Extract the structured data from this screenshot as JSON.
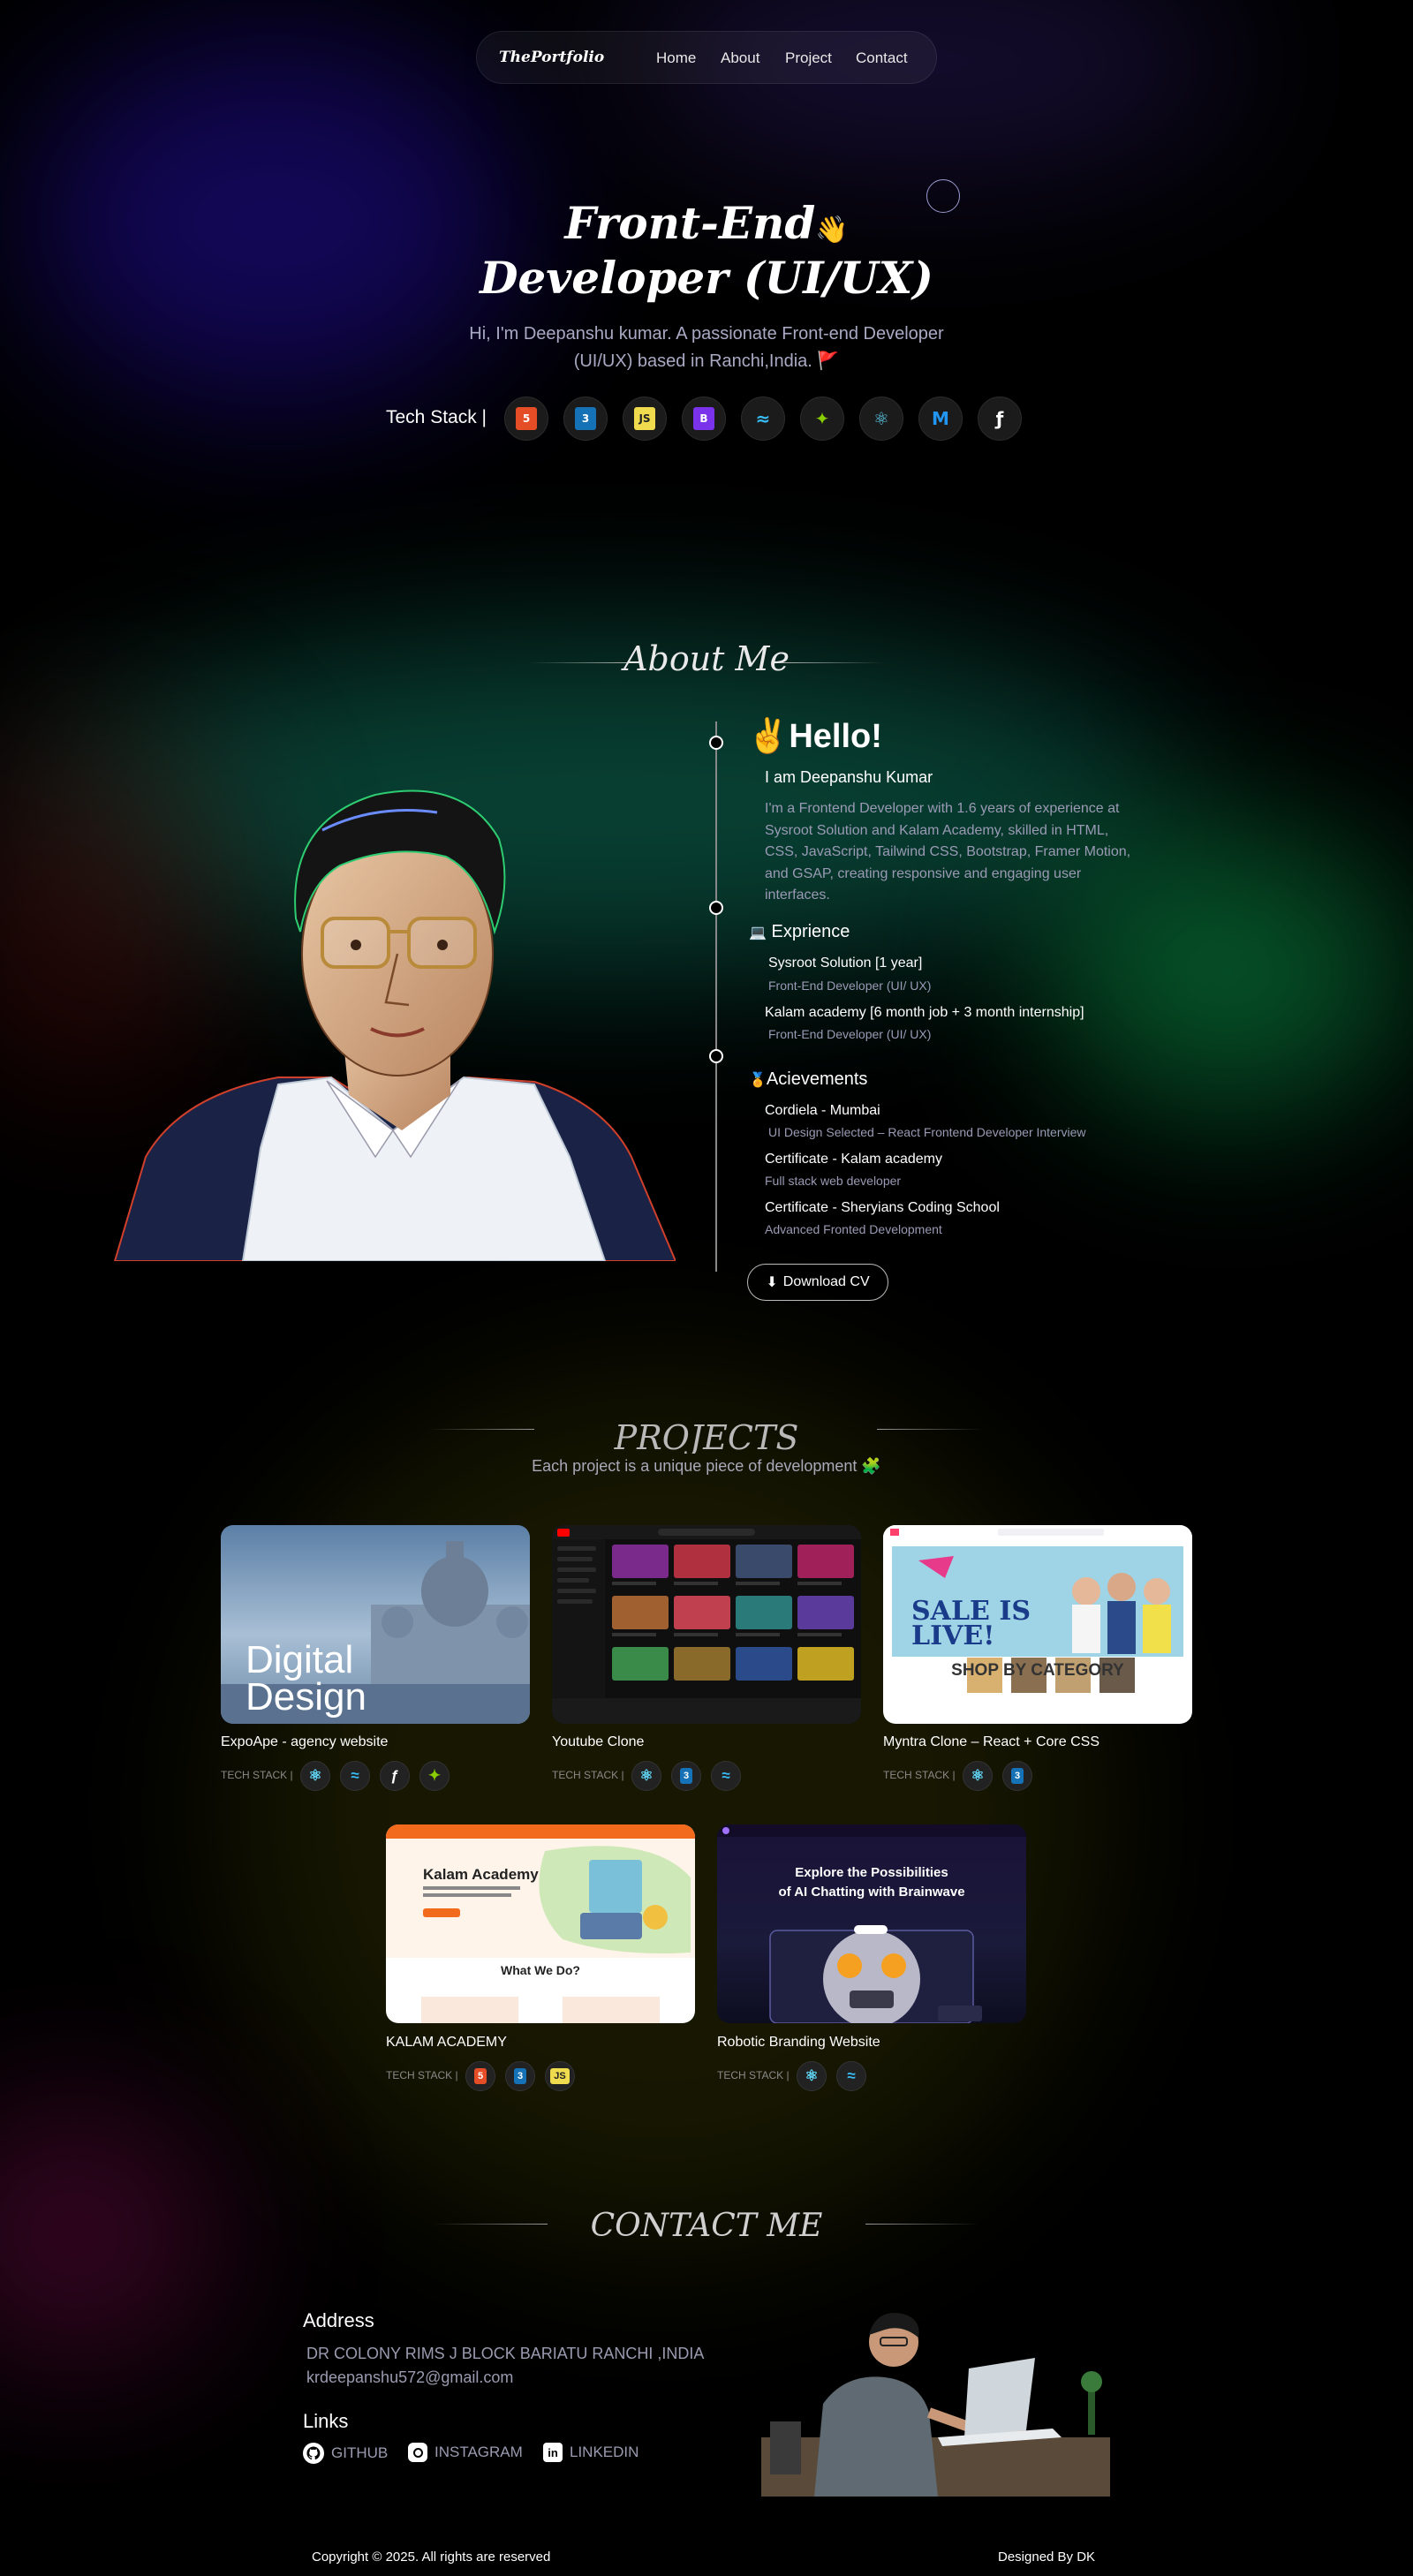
{
  "nav": {
    "logo": "ThePortfolio",
    "links": [
      "Home",
      "About",
      "Project",
      "Contact"
    ]
  },
  "hero": {
    "title_line1": "Front-End",
    "title_emoji": "👋",
    "title_line2": "Developer (UI/UX)",
    "subtitle_line1": "Hi, I'm Deepanshu kumar. A passionate Front-end Developer",
    "subtitle_line2": "(UI/UX) based in Ranchi,India.",
    "subtitle_flag": "🚩",
    "tech_label": "Tech Stack  |",
    "tech_icons": [
      {
        "icon": "html5-icon",
        "text": "5",
        "bg": "#e44d26",
        "fg": "#fff"
      },
      {
        "icon": "css3-icon",
        "text": "3",
        "bg": "#1572b6",
        "fg": "#fff"
      },
      {
        "icon": "javascript-icon",
        "text": "JS",
        "bg": "#f0db4f",
        "fg": "#222"
      },
      {
        "icon": "bootstrap-icon",
        "text": "B",
        "bg": "#7a33ea",
        "fg": "#fff"
      },
      {
        "icon": "tailwind-icon",
        "text": "≈",
        "bg": "transparent",
        "fg": "#38bdf8"
      },
      {
        "icon": "gsap-icon",
        "text": "✦",
        "bg": "transparent",
        "fg": "#88ce02"
      },
      {
        "icon": "react-icon",
        "text": "⚛",
        "bg": "transparent",
        "fg": "#61dafb"
      },
      {
        "icon": "mui-icon",
        "text": "M",
        "bg": "transparent",
        "fg": "#2196f3"
      },
      {
        "icon": "framer-motion-icon",
        "text": "ƒ",
        "bg": "transparent",
        "fg": "#fff"
      }
    ]
  },
  "about": {
    "heading": "About Me",
    "hello_emoji": "✌",
    "hello": "Hello!",
    "name": "I am Deepanshu Kumar",
    "bio_lines": [
      "I'm a Frontend Developer with 1.6 years of experience at",
      "Sysroot Solution and Kalam Academy, skilled in HTML,",
      "CSS, JavaScript, Tailwind CSS, Bootstrap, Framer Motion,",
      "and GSAP, creating responsive and engaging user",
      "interfaces."
    ],
    "experience_emoji": "💻",
    "experience_title": "Exprience",
    "experience": [
      {
        "company": "Sysroot Solution [1 year]",
        "role": "Front-End Developer (UI/ UX)"
      },
      {
        "company": "Kalam academy [6 month job + 3 month internship]",
        "role": "Front-End Developer (UI/ UX)"
      }
    ],
    "achievements_emoji": "🏅",
    "achievements_title": "Acievements",
    "achievements": [
      {
        "title": "Cordiela - Mumbai",
        "desc": "UI Design Selected – React Frontend Developer Interview"
      },
      {
        "title": "Certificate - Kalam academy",
        "desc": "Full stack web developer"
      },
      {
        "title": "Certificate - Sheryians Coding School",
        "desc": "Advanced Fronted Development"
      }
    ],
    "download_cv": "Download CV"
  },
  "projects": {
    "heading": "PROJECTS",
    "subtitle": "Each project is a unique piece of development",
    "subtitle_emoji": "🧩",
    "tech_label": "TECH STACK |",
    "items": [
      {
        "title": "ExpoApe - agency website",
        "thumb_text_1": "Digital",
        "thumb_text_2": "Design",
        "stack": [
          "react-icon",
          "tailwind-icon",
          "framer-motion-icon",
          "gsap-icon"
        ]
      },
      {
        "title": "Youtube Clone",
        "stack": [
          "react-icon",
          "css3-icon",
          "tailwind-icon"
        ]
      },
      {
        "title": "Myntra Clone – React + Core CSS",
        "thumb_text_1": "SALE IS",
        "thumb_text_2": "LIVE!",
        "thumb_text_3": "SHOP BY CATEGORY",
        "stack": [
          "react-icon",
          "css3-icon"
        ]
      },
      {
        "title": "KALAM ACADEMY",
        "thumb_text_1": "Kalam Academy",
        "thumb_text_2": "What We Do?",
        "stack": [
          "html5-icon",
          "css3-icon",
          "javascript-icon"
        ]
      },
      {
        "title": "Robotic Branding Website",
        "thumb_text_1": "Explore the Possibilities",
        "thumb_text_2": "of AI Chatting with Brainwave",
        "stack": [
          "react-icon",
          "tailwind-icon"
        ]
      }
    ]
  },
  "contact": {
    "heading": "CONTACT ME",
    "address_title": "Address",
    "address": "DR COLONY RIMS J BLOCK BARIATU RANCHI ,INDIA",
    "email": "krdeepanshu572@gmail.com",
    "links_title": "Links",
    "links": [
      {
        "icon": "github-icon",
        "label": "GITHUB"
      },
      {
        "icon": "instagram-icon",
        "label": "INSTAGRAM"
      },
      {
        "icon": "linkedin-icon",
        "label": "LINKEDIN"
      }
    ]
  },
  "footer": {
    "copyright": "Copyright © 2025. All rights are reserved",
    "designed_by": "Designed By DK"
  },
  "colors": {
    "background": "#000000",
    "muted_text": "#9a9ab5",
    "accent_orange": "#f26a1b",
    "accent_green": "#0d8a52"
  }
}
